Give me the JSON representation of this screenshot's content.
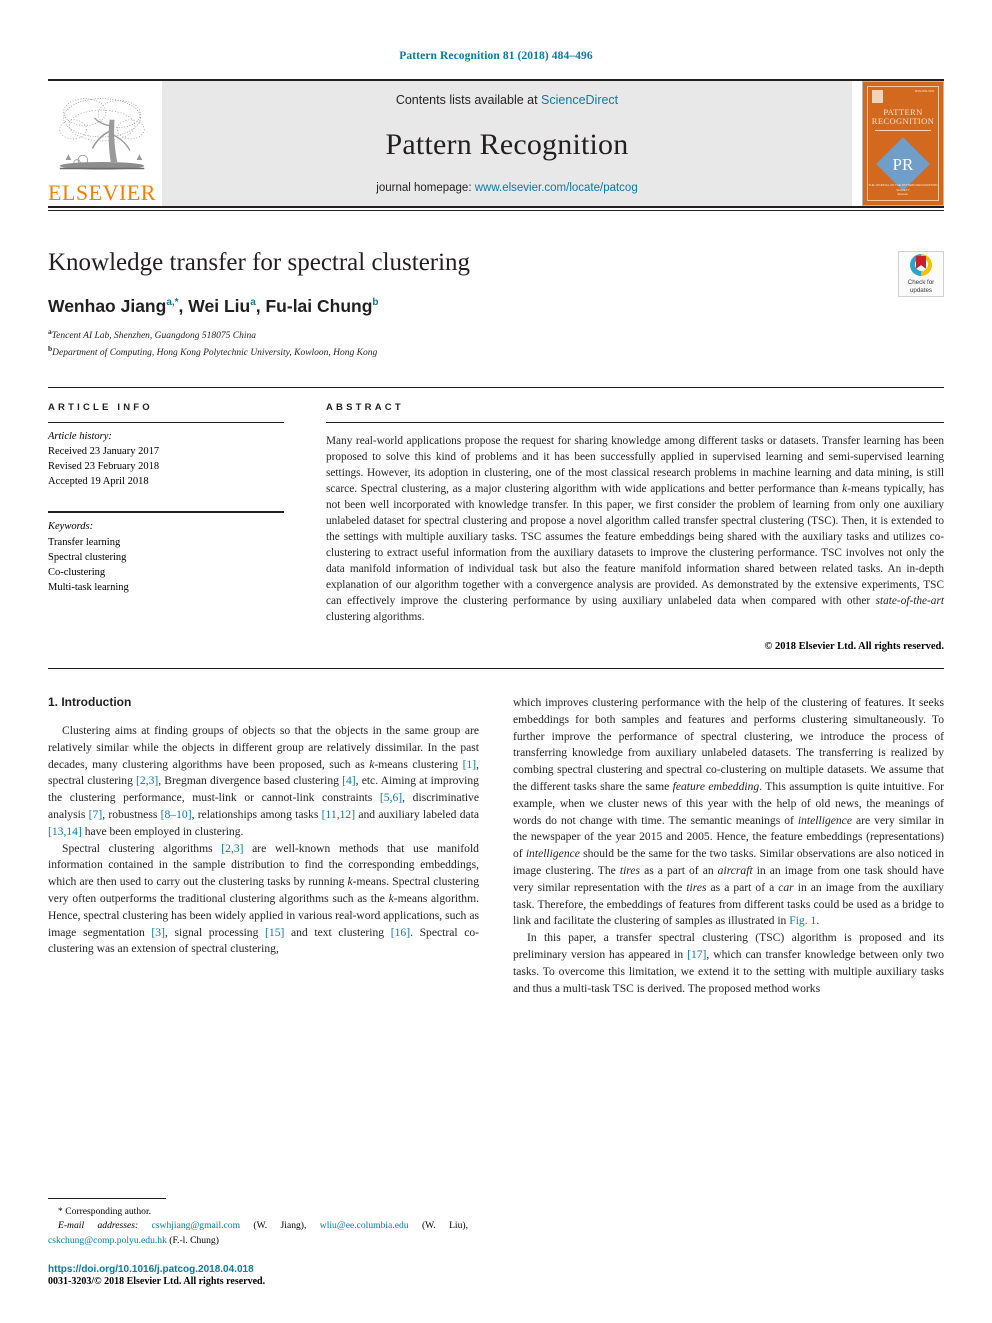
{
  "running_head": "Pattern Recognition 81 (2018) 484–496",
  "masthead": {
    "publisher_name": "ELSEVIER",
    "contents_prefix": "Contents lists available at ",
    "contents_link": "ScienceDirect",
    "journal_title": "Pattern Recognition",
    "homepage_prefix": "journal homepage: ",
    "homepage_link": "www.elsevier.com/locate/patcog",
    "cover": {
      "issn_text": "ISSN 0031-3203",
      "name_line1": "PATTERN",
      "name_line2": "RECOGNITION",
      "monogram": "PR",
      "foot_line1": "THE JOURNAL OF THE PATTERN RECOGNITION SOCIETY",
      "foot_line2": "Elsevier"
    }
  },
  "article": {
    "title": "Knowledge transfer for spectral clustering",
    "authors": [
      {
        "name": "Wenhao Jiang",
        "marks": "a,*"
      },
      {
        "name": "Wei Liu",
        "marks": "a"
      },
      {
        "name": "Fu-lai Chung",
        "marks": "b"
      }
    ],
    "affiliations": [
      {
        "mark": "a",
        "text": "Tencent AI Lab, Shenzhen, Guangdong 518075 China"
      },
      {
        "mark": "b",
        "text": "Department of Computing, Hong Kong Polytechnic University, Kowloon, Hong Kong"
      }
    ],
    "crossmark": {
      "line1": "Check for",
      "line2": "updates"
    }
  },
  "article_info": {
    "heading": "ARTICLE INFO",
    "history_label": "Article history:",
    "history": [
      "Received 23 January 2017",
      "Revised 23 February 2018",
      "Accepted 19 April 2018"
    ],
    "keywords_label": "Keywords:",
    "keywords": [
      "Transfer learning",
      "Spectral clustering",
      "Co-clustering",
      "Multi-task learning"
    ]
  },
  "abstract": {
    "heading": "ABSTRACT",
    "text": "Many real-world applications propose the request for sharing knowledge among different tasks or datasets. Transfer learning has been proposed to solve this kind of problems and it has been successfully applied in supervised learning and semi-supervised learning settings. However, its adoption in clustering, one of the most classical research problems in machine learning and data mining, is still scarce. Spectral clustering, as a major clustering algorithm with wide applications and better performance than k-means typically, has not been well incorporated with knowledge transfer. In this paper, we first consider the problem of learning from only one auxiliary unlabeled dataset for spectral clustering and propose a novel algorithm called transfer spectral clustering (TSC). Then, it is extended to the settings with multiple auxiliary tasks. TSC assumes the feature embeddings being shared with the auxiliary tasks and utilizes co-clustering to extract useful information from the auxiliary datasets to improve the clustering performance. TSC involves not only the data manifold information of individual task but also the feature manifold information shared between related tasks. An in-depth explanation of our algorithm together with a convergence analysis are provided. As demonstrated by the extensive experiments, TSC can effectively improve the clustering performance by using auxiliary unlabeled data when compared with other state-of-the-art clustering algorithms.",
    "copyright": "© 2018 Elsevier Ltd. All rights reserved."
  },
  "introduction": {
    "heading": "1. Introduction",
    "left_paragraphs": [
      "Clustering aims at finding groups of objects so that the objects in the same group are relatively similar while the objects in different group are relatively dissimilar. In the past decades, many clustering algorithms have been proposed, such as k-means clustering [1], spectral clustering [2,3], Bregman divergence based clustering [4], etc. Aiming at improving the clustering performance, must-link or cannot-link constraints [5,6], discriminative analysis [7], robustness [8–10], relationships among tasks [11,12] and auxiliary labeled data [13,14] have been employed in clustering.",
      "Spectral clustering algorithms [2,3] are well-known methods that use manifold information contained in the sample distribution to find the corresponding embeddings, which are then used to carry out the clustering tasks by running k-means. Spectral clustering very often outperforms the traditional clustering algorithms such as the k-means algorithm. Hence, spectral clustering has been widely applied in various real-word applications, such as image segmentation [3], signal processing [15] and text clustering [16]. Spectral co-clustering was an extension of spectral clustering,"
    ],
    "right_paragraphs": [
      "which improves clustering performance with the help of the clustering of features. It seeks embeddings for both samples and features and performs clustering simultaneously. To further improve the performance of spectral clustering, we introduce the process of transferring knowledge from auxiliary unlabeled datasets. The transferring is realized by combing spectral clustering and spectral co-clustering on multiple datasets. We assume that the different tasks share the same feature embedding. This assumption is quite intuitive. For example, when we cluster news of this year with the help of old news, the meanings of words do not change with time. The semantic meanings of intelligence are very similar in the newspaper of the year 2015 and 2005. Hence, the feature embeddings (representations) of intelligence should be the same for the two tasks. Similar observations are also noticed in image clustering. The tires as a part of an aircraft in an image from one task should have very similar representation with the tires as a part of a car in an image from the auxiliary task. Therefore, the embeddings of features from different tasks could be used as a bridge to link and facilitate the clustering of samples as illustrated in Fig. 1.",
      "In this paper, a transfer spectral clustering (TSC) algorithm is proposed and its preliminary version has appeared in [17], which can transfer knowledge between only two tasks. To overcome this limitation, we extend it to the setting with multiple auxiliary tasks and thus a multi-task TSC is derived. The proposed method works"
    ]
  },
  "footnote": {
    "corresponding": "Corresponding author.",
    "email_label": "E-mail addresses:",
    "emails": [
      {
        "address": "cswhjiang@gmail.com",
        "who": "(W. Jiang)"
      },
      {
        "address": "wliu@ee.columbia.edu",
        "who": "(W. Liu)"
      },
      {
        "address": "cskchung@comp.polyu.edu.hk",
        "who": "(F.-l. Chung)"
      }
    ],
    "doi": "https://doi.org/10.1016/j.patcog.2018.04.018",
    "issn_line": "0031-3203/© 2018 Elsevier Ltd. All rights reserved."
  },
  "colors": {
    "link": "#0b7aa5",
    "elsevier_orange": "#f08000",
    "cover_orange": "#d2691e",
    "ink": "#231f20"
  }
}
